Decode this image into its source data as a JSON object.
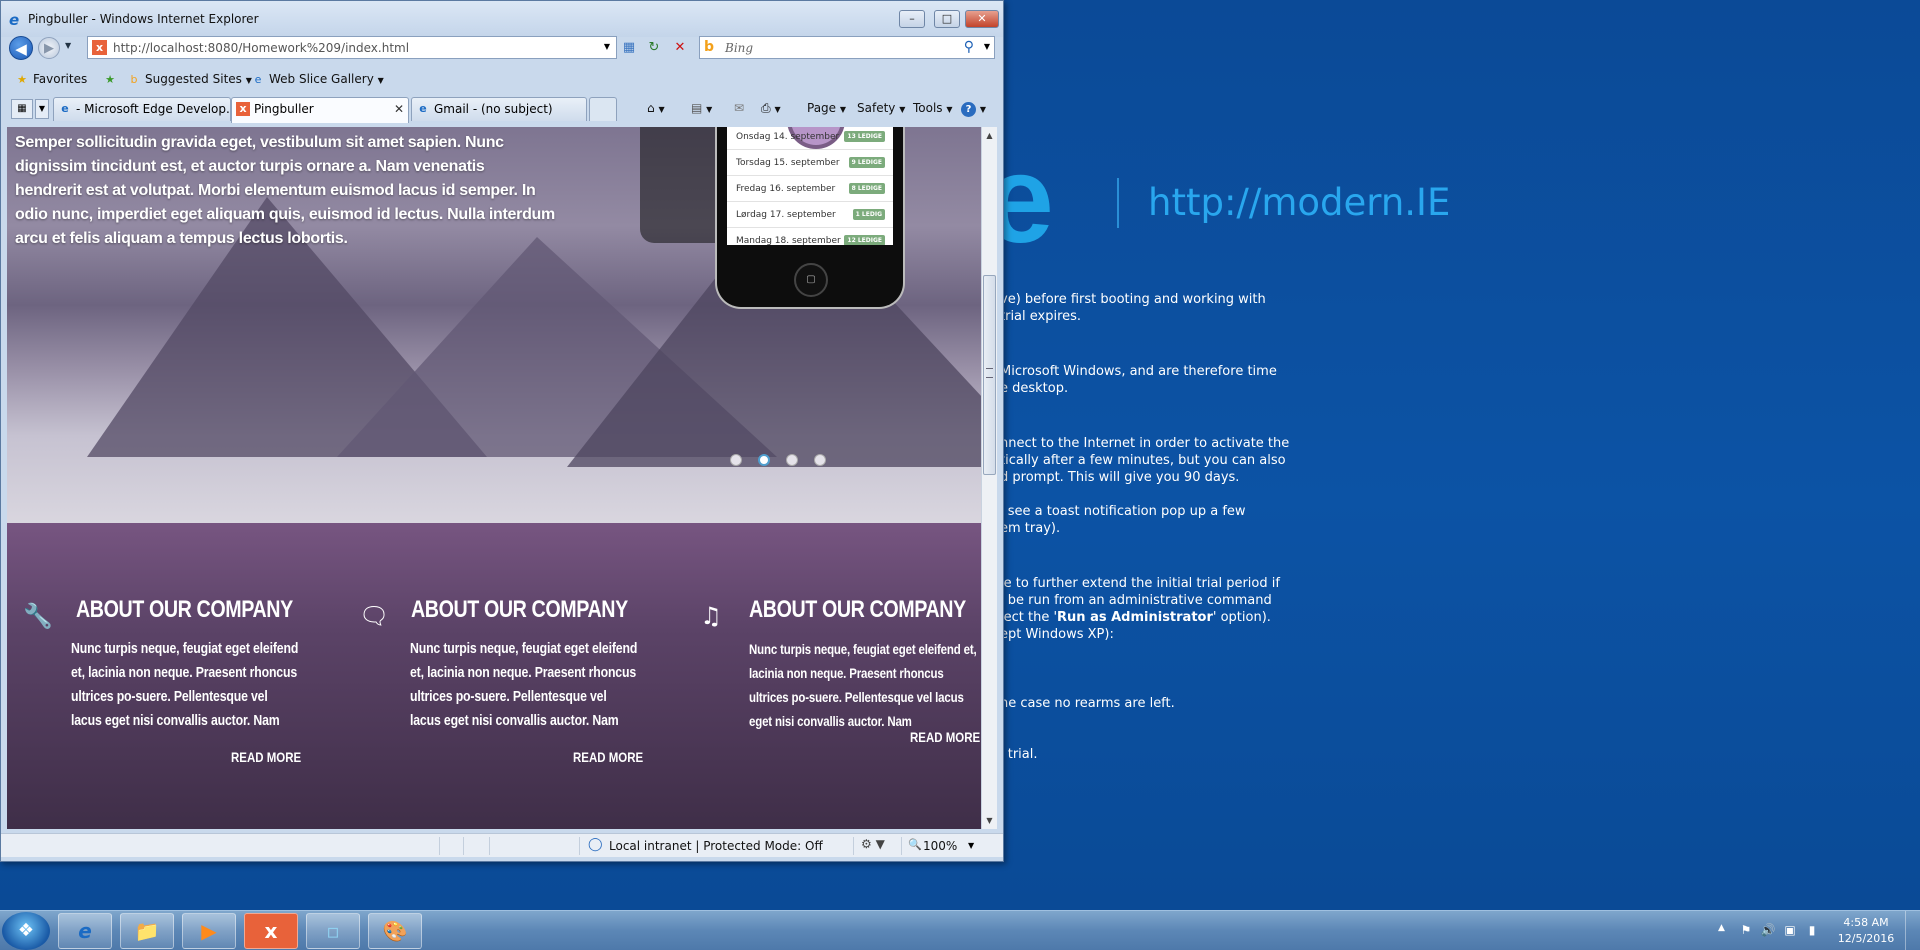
{
  "window": {
    "title": "Pingbuller - Windows Internet Explorer",
    "minimize": "–",
    "maximize": "□",
    "close": "✕"
  },
  "nav": {
    "back_icon": "arrow-left-icon",
    "forward_icon": "arrow-right-icon",
    "address": "http://localhost:8080/Homework%209/index.html",
    "search_placeholder": "Bing"
  },
  "favorites_bar": {
    "favorites_label": "Favorites",
    "suggested_sites": "Suggested Sites",
    "web_slice_gallery": "Web Slice Gallery"
  },
  "tabs": [
    {
      "label": "- Microsoft Edge Develop...",
      "active": false
    },
    {
      "label": "Pingbuller",
      "active": true
    },
    {
      "label": "Gmail - (no subject)",
      "active": false
    }
  ],
  "command_bar": {
    "page": "Page",
    "safety": "Safety",
    "tools": "Tools",
    "help": "?"
  },
  "hero": {
    "text": "Semper sollicitudin gravida eget, vestibulum sit amet sapien. Nunc dignissim tincidunt est, et auctor turpis ornare a. Nam venenatis hendrerit est at volutpat. Morbi elementum euismod lacus id semper. In odio nunc, imperdiet eget aliquam quis, euismod id lectus. Nulla interdum arcu et felis aliquam a tempus lectus lobortis.",
    "phone_rows": [
      {
        "day": "Onsdag 14. september",
        "badge": "13 LEDIGE"
      },
      {
        "day": "Torsdag 15. september",
        "badge": "9 LEDIGE"
      },
      {
        "day": "Fredag 16. september",
        "badge": "8 LEDIGE"
      },
      {
        "day": "Lørdag 17. september",
        "badge": "1 LEDIG"
      },
      {
        "day": "Mandag 18. september",
        "badge": "12 LEDIGE"
      }
    ],
    "slider_active_index": 1,
    "slider_count": 4
  },
  "features": [
    {
      "icon": "wrench-icon",
      "title": "ABOUT OUR COMPANY",
      "body": "Nunc turpis neque, feugiat eget eleifend et, lacinia non neque. Praesent rhoncus ultrices po-suere. Pellentesque vel lacus eget nisi convallis auctor. Nam",
      "more": "READ MORE"
    },
    {
      "icon": "speech-bubble-icon",
      "title": "ABOUT OUR COMPANY",
      "body": "Nunc turpis neque, feugiat eget eleifend et, lacinia non neque. Praesent rhoncus ultrices po-suere. Pellentesque vel lacus eget nisi convallis auctor. Nam",
      "more": "READ MORE"
    },
    {
      "icon": "music-note-icon",
      "title": "ABOUT OUR COMPANY",
      "body": "Nunc turpis neque, feugiat eget eleifend et, lacinia non neque. Praesent rhoncus ultrices po-suere. Pellentesque vel lacus eget nisi convallis auctor. Nam",
      "more": "READ MORE"
    }
  ],
  "status": {
    "zone": "Local intranet | Protected Mode: Off",
    "zoom": "100%"
  },
  "desktop": {
    "logo_letter": "e",
    "url": "http://modern.IE",
    "lines": [
      "ve) before first booting and working with",
      "trial expires.",
      "Microsoft Windows, and are therefore time",
      "e desktop.",
      "nnect to the Internet in order to activate the",
      "tically after a few minutes, but you can also",
      "d prompt. This will give you 90 days.",
      "l see a toast notification pop up a few",
      "em tray).",
      "le to further extend the initial trial period if",
      "l be run from an administrative command",
      "lect the '",
      "Run as Administrator",
      "' option).",
      "ept Windows XP):",
      "he case no rearms are left.",
      "l trial."
    ]
  },
  "taskbar": {
    "time": "4:58 AM",
    "date": "12/5/2016"
  }
}
